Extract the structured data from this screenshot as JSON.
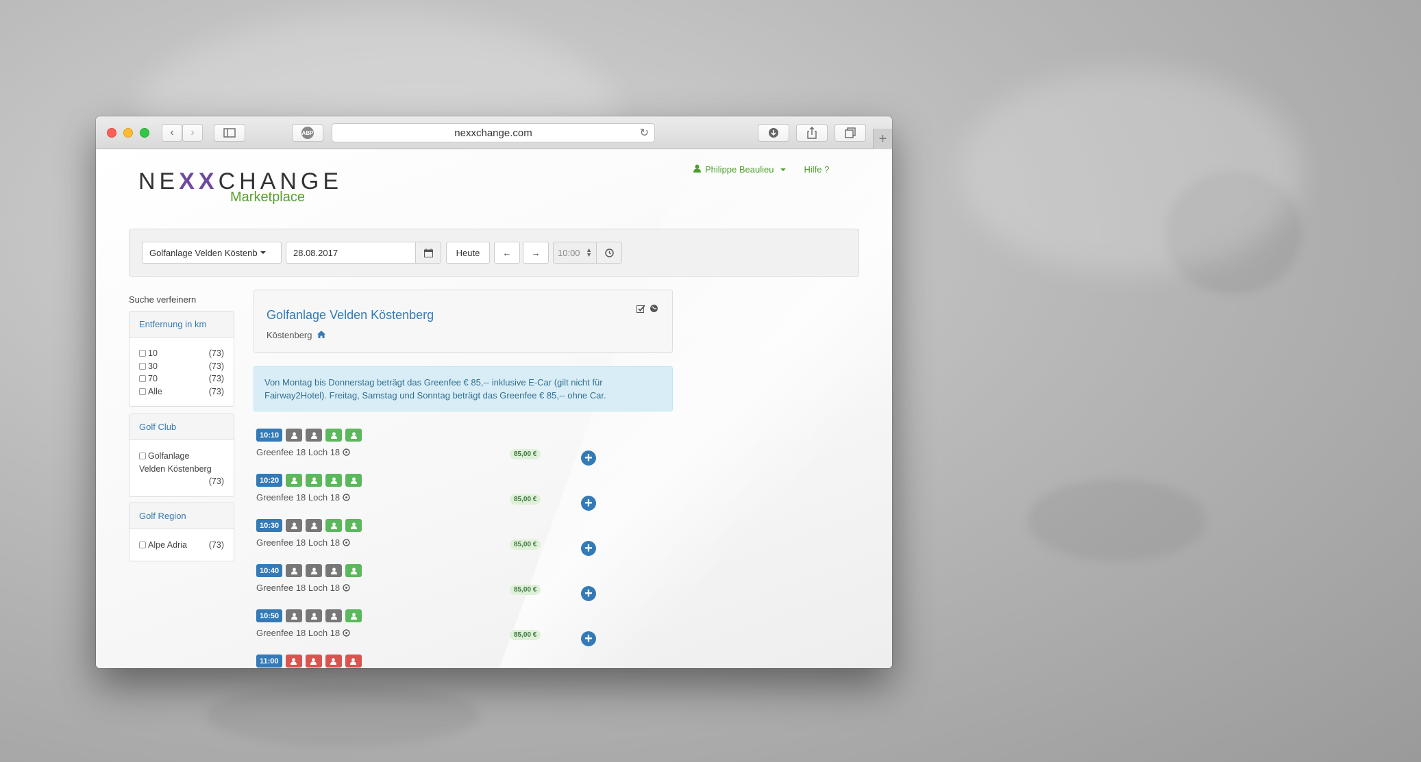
{
  "browser": {
    "url": "nexxchange.com",
    "abp_label": "ABP"
  },
  "header": {
    "logo_part1": "NE",
    "logo_x": "XX",
    "logo_part2": "CHANGE",
    "logo_sub": "Marketplace",
    "user_name": "Philippe Beaulieu",
    "help": "Hilfe ?"
  },
  "toolbar": {
    "course_select": "Golfanlage Velden Köstenb",
    "date": "28.08.2017",
    "today": "Heute",
    "time": "10:00"
  },
  "sidebar": {
    "title": "Suche verfeinern",
    "distance": {
      "heading": "Entfernung in km",
      "options": [
        {
          "label": "10",
          "count": "(73)"
        },
        {
          "label": "30",
          "count": "(73)"
        },
        {
          "label": "70",
          "count": "(73)"
        },
        {
          "label": "Alle",
          "count": "(73)"
        }
      ]
    },
    "club": {
      "heading": "Golf Club",
      "option_line1": "Golfanlage",
      "option_line2": "Velden Köstenberg",
      "count": "(73)"
    },
    "region": {
      "heading": "Golf Region",
      "option": "Alpe Adria",
      "count": "(73)"
    }
  },
  "course": {
    "title": "Golfanlage Velden Köstenberg",
    "location": "Köstenberg"
  },
  "info_text": "Von Montag bis Donnerstag beträgt das Greenfee € 85,-- inklusive E-Car (gilt nicht für Fairway2Hotel). Freitag, Samstag und Sonntag beträgt das Greenfee € 85,-- ohne Car.",
  "slots": [
    {
      "time": "10:10",
      "players": [
        "grey",
        "grey",
        "green",
        "green"
      ],
      "label": "Greenfee 18 Loch 18",
      "price": "85,00 €"
    },
    {
      "time": "10:20",
      "players": [
        "green",
        "green",
        "green",
        "green"
      ],
      "label": "Greenfee 18 Loch 18",
      "price": "85,00 €"
    },
    {
      "time": "10:30",
      "players": [
        "grey",
        "grey",
        "green",
        "green"
      ],
      "label": "Greenfee 18 Loch 18",
      "price": "85,00 €"
    },
    {
      "time": "10:40",
      "players": [
        "grey",
        "grey",
        "grey",
        "green"
      ],
      "label": "Greenfee 18 Loch 18",
      "price": "85,00 €"
    },
    {
      "time": "10:50",
      "players": [
        "grey",
        "grey",
        "grey",
        "green"
      ],
      "label": "Greenfee 18 Loch 18",
      "price": "85,00 €"
    },
    {
      "time": "11:00",
      "players": [
        "red",
        "red",
        "red",
        "red"
      ],
      "label": "",
      "price": ""
    }
  ],
  "colors": {
    "primary": "#337ab7",
    "brand_green": "#5a9e2e",
    "player_green": "#5cb85c",
    "player_grey": "#777777",
    "player_red": "#d9534f"
  }
}
